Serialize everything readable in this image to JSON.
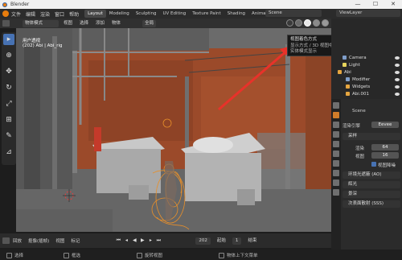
{
  "window": {
    "title": "Blender",
    "controls": [
      "—",
      "☐",
      "✕"
    ]
  },
  "menu": [
    "文件",
    "编辑",
    "渲染",
    "窗口",
    "帮助"
  ],
  "workspaces": [
    {
      "label": "Layout",
      "active": true
    },
    {
      "label": "Modeling",
      "active": false
    },
    {
      "label": "Sculpting",
      "active": false
    },
    {
      "label": "UV Editing",
      "active": false
    },
    {
      "label": "Texture Paint",
      "active": false
    },
    {
      "label": "Shading",
      "active": false
    },
    {
      "label": "Animation",
      "active": false
    }
  ],
  "scene_name": "Scene",
  "view_layer": "ViewLayer",
  "viewport_header": {
    "mode": "物体模式",
    "menus": [
      "视图",
      "选择",
      "添加",
      "物体"
    ],
    "orientation": "全局"
  },
  "viewport": {
    "view_name": "用户透视",
    "collection_info": "(202) Abi | Abi_rig"
  },
  "tooltip": {
    "title": "视图着色方式",
    "line2": "显示方式 / 3D 视图中的物体着色类型: 实体",
    "line3": "实体模式显示"
  },
  "outliner": {
    "rows": [
      {
        "label": "Camera",
        "icon_color": "#7f9ec9"
      },
      {
        "label": "Light",
        "icon_color": "#e6d45c"
      },
      {
        "label": "Abi",
        "icon_color": "#e6a640"
      },
      {
        "label": "Modifier",
        "icon_color": "#7f9ec9"
      },
      {
        "label": "Widgets",
        "icon_color": "#e6a640"
      },
      {
        "label": "Abi.001",
        "icon_color": "#e6a640"
      }
    ]
  },
  "properties": {
    "scene": "Scene",
    "render_engine_label": "渲染引擎",
    "render_engine_value": "Eevee",
    "sampling": "采样",
    "render_label": "渲染",
    "render_value": "64",
    "viewport_label": "视图",
    "viewport_value": "16",
    "denoise": "视图降噪",
    "ao": "环境光遮蔽 (AO)",
    "bloom": "辉光",
    "dof": "景深",
    "sss": "次表面散射 (SSS)"
  },
  "timeline": {
    "menus": [
      "回放",
      "抠像(插帧)",
      "视图",
      "标记"
    ],
    "current_frame": "202",
    "start_label": "起始",
    "start_value": "1",
    "end_label": "结束"
  },
  "statusbar": {
    "items": [
      "选择",
      "框选",
      "旋转视图",
      "物体上下文菜单"
    ]
  },
  "colors": {
    "accent": "#4772b3",
    "selection": "#e88f2a",
    "annotation_arrow": "#e8322a",
    "wall_brick": "#9b4a2a"
  }
}
